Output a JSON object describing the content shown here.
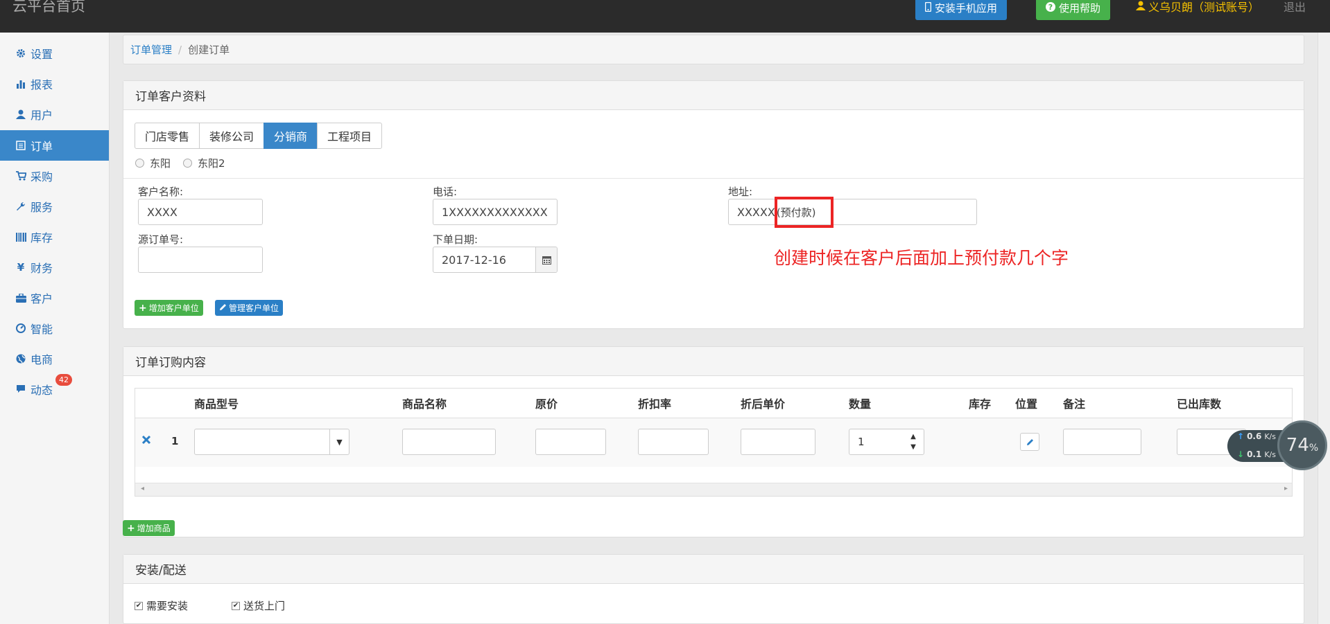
{
  "topbar": {
    "brand": "云平台首页",
    "install_app": "安装手机应用",
    "help": "使用帮助",
    "user": "义乌贝朗（测试账号）",
    "logout": "退出"
  },
  "sidebar": {
    "items": [
      {
        "label": "设置",
        "icon": "gear-icon"
      },
      {
        "label": "报表",
        "icon": "bar-chart-icon"
      },
      {
        "label": "用户",
        "icon": "user-icon"
      },
      {
        "label": "订单",
        "icon": "list-icon"
      },
      {
        "label": "采购",
        "icon": "cart-icon"
      },
      {
        "label": "服务",
        "icon": "wrench-icon"
      },
      {
        "label": "库存",
        "icon": "barcode-icon"
      },
      {
        "label": "财务",
        "icon": "yen-icon"
      },
      {
        "label": "客户",
        "icon": "briefcase-icon"
      },
      {
        "label": "智能",
        "icon": "dashboard-icon"
      },
      {
        "label": "电商",
        "icon": "globe-icon"
      },
      {
        "label": "动态",
        "icon": "comment-icon"
      }
    ],
    "active_index": 3,
    "badge": "42"
  },
  "breadcrumb": {
    "parent": "订单管理",
    "sep": "/",
    "current": "创建订单"
  },
  "customer_panel": {
    "title": "订单客户资料",
    "tabs": [
      "门店零售",
      "装修公司",
      "分销商",
      "工程项目"
    ],
    "active_tab": 2,
    "radios": [
      "东阳",
      "东阳2"
    ],
    "fields": {
      "name_label": "客户名称:",
      "name_value": "XXXX",
      "phone_label": "电话:",
      "phone_value": "1XXXXXXXXXXXXX",
      "address_label": "地址:",
      "address_value": "XXXXX",
      "address_suffix": "(预付款)",
      "source_label": "源订单号:",
      "source_value": "",
      "date_label": "下单日期:",
      "date_value": "2017-12-16"
    },
    "annotation": "创建时候在客户后面加上预付款几个字",
    "add_unit": "增加客户单位",
    "manage_unit": "管理客户单位"
  },
  "order_panel": {
    "title": "订单订购内容",
    "columns": [
      "商品型号",
      "商品名称",
      "原价",
      "折扣率",
      "折后单价",
      "数量",
      "库存",
      "位置",
      "备注",
      "已出库数"
    ],
    "row": {
      "index": "1",
      "quantity": "1"
    },
    "add_product": "增加商品"
  },
  "delivery_panel": {
    "title": "安装/配送",
    "need_install": "需要安装",
    "deliver": "送货上门"
  },
  "speed_widget": {
    "up": "0.6",
    "down": "0.1",
    "unit": "K/s",
    "percent": "74",
    "percent_sign": "%"
  },
  "colors": {
    "topbar": "#2b2b2b",
    "primary": "#3a87c9",
    "success": "#47b14b",
    "annotation": "#ec2424",
    "user": "#f5c000"
  }
}
